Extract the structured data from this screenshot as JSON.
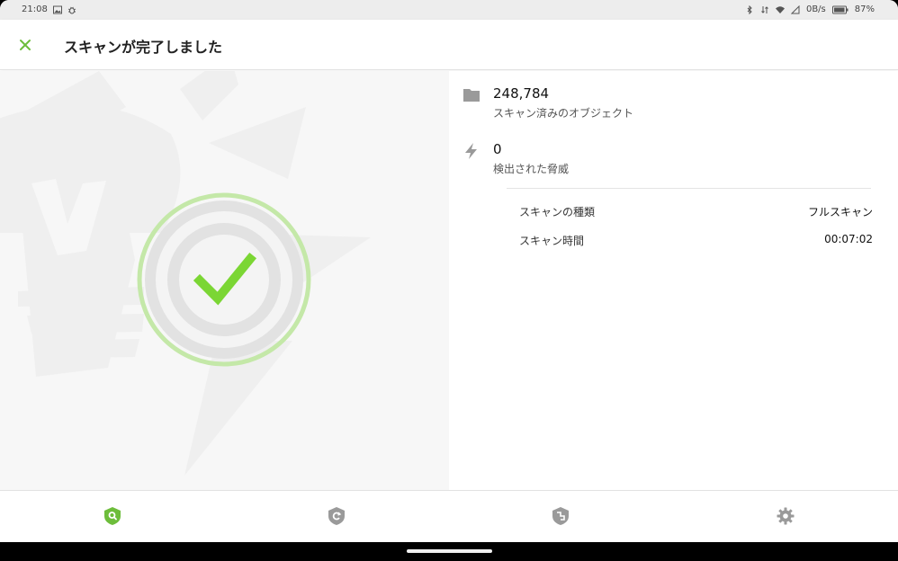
{
  "status_bar": {
    "time": "21:08",
    "network_speed": "0B/s",
    "battery": "87%"
  },
  "app_bar": {
    "title": "スキャンが完了しました"
  },
  "results": {
    "objects": {
      "value": "248,784",
      "label": "スキャン済みのオブジェクト"
    },
    "threats": {
      "value": "0",
      "label": "検出された脅威"
    },
    "details": [
      {
        "key": "スキャンの種類",
        "value": "フルスキャン"
      },
      {
        "key": "スキャン時間",
        "value": "00:07:02"
      }
    ]
  },
  "colors": {
    "accent": "#6dbd3b",
    "check": "#7bd634",
    "icon_gray": "#9a9a9a",
    "ring_outer": "#c4e8a8"
  },
  "bottom_nav": [
    {
      "icon": "shield-search-icon",
      "active": true
    },
    {
      "icon": "shield-refresh-icon",
      "active": false
    },
    {
      "icon": "shield-firewall-icon",
      "active": false
    },
    {
      "icon": "gear-icon",
      "active": false
    }
  ]
}
